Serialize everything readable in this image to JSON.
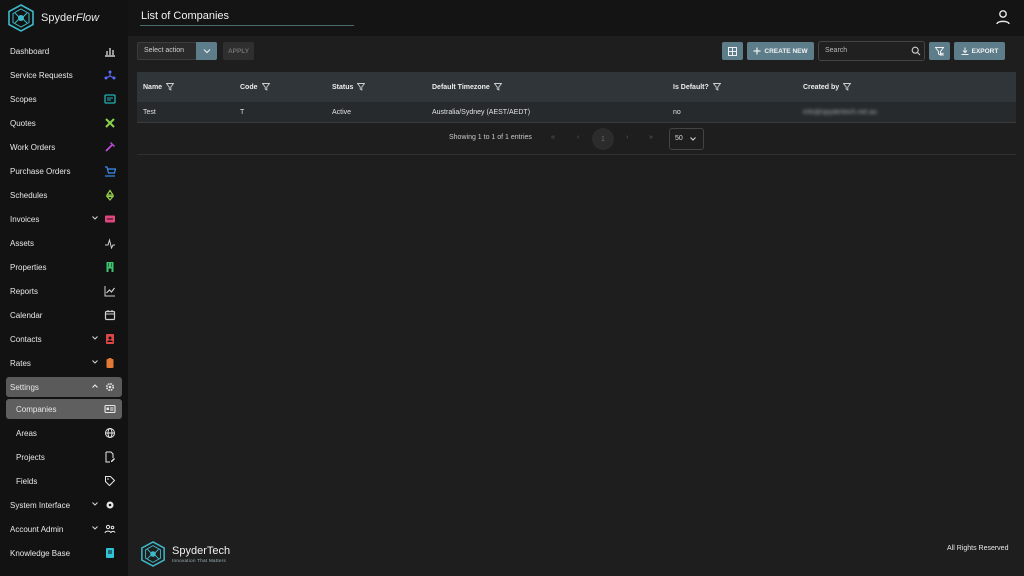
{
  "app": {
    "brand_prefix": "Spyder",
    "brand_suffix": "Flow",
    "page_title": "List of Companies"
  },
  "sidebar": {
    "items": [
      {
        "label": "Dashboard",
        "icon": "chart-bar-icon",
        "color": "#cfcfcf"
      },
      {
        "label": "Service Requests",
        "icon": "network-icon",
        "color": "#5a6cff"
      },
      {
        "label": "Scopes",
        "icon": "scope-icon",
        "color": "#1fb3b3"
      },
      {
        "label": "Quotes",
        "icon": "tools-icon",
        "color": "#8bd24b"
      },
      {
        "label": "Work Orders",
        "icon": "hammer-icon",
        "color": "#c04bd8"
      },
      {
        "label": "Purchase Orders",
        "icon": "cart-icon",
        "color": "#3b8cf0"
      },
      {
        "label": "Schedules",
        "icon": "recycle-icon",
        "color": "#9ad24b"
      },
      {
        "label": "Invoices",
        "icon": "invoice-icon",
        "color": "#e0457d"
      },
      {
        "label": "Assets",
        "icon": "pulse-icon",
        "color": "#cfcfcf"
      },
      {
        "label": "Properties",
        "icon": "building-icon",
        "color": "#3ec46d"
      },
      {
        "label": "Reports",
        "icon": "trend-icon",
        "color": "#cfcfcf"
      },
      {
        "label": "Calendar",
        "icon": "calendar-icon",
        "color": "#cfcfcf"
      },
      {
        "label": "Contacts",
        "icon": "contact-icon",
        "color": "#e04848"
      },
      {
        "label": "Rates",
        "icon": "clipboard-icon",
        "color": "#e07a34"
      },
      {
        "label": "Settings",
        "icon": "gear-icon",
        "color": "#e8e8e8"
      },
      {
        "label": "Companies",
        "icon": "id-card-icon",
        "color": "#e8e8e8"
      },
      {
        "label": "Areas",
        "icon": "globe-icon",
        "color": "#e8e8e8"
      },
      {
        "label": "Projects",
        "icon": "edit-doc-icon",
        "color": "#e8e8e8"
      },
      {
        "label": "Fields",
        "icon": "tag-icon",
        "color": "#e8e8e8"
      },
      {
        "label": "System Interface",
        "icon": "cog-icon",
        "color": "#e8e8e8"
      },
      {
        "label": "Account Admin",
        "icon": "users-icon",
        "color": "#e8e8e8"
      },
      {
        "label": "Knowledge Base",
        "icon": "book-icon",
        "color": "#2fc4d6"
      }
    ]
  },
  "toolbar": {
    "select_placeholder": "Select action",
    "apply_label": "APPLY",
    "create_label": "CREATE NEW",
    "search_placeholder": "Search",
    "export_label": "EXPORT"
  },
  "table": {
    "columns": [
      "Name",
      "Code",
      "Status",
      "Default Timezone",
      "Is Default?",
      "Created by"
    ],
    "rows": [
      [
        "Test",
        "T",
        "Active",
        "Australia/Sydney (AEST/AEDT)",
        "no",
        "info@spydertech.net.au"
      ]
    ]
  },
  "pagination": {
    "summary": "Showing 1 to 1 of 1 entries",
    "first": "«",
    "prev": "‹",
    "current": "1",
    "next": "›",
    "last": "»",
    "page_size": "50"
  },
  "footer": {
    "brand": "SpyderTech",
    "tagline": "Innovation That Matters",
    "rights": "All Rights Reserved"
  }
}
